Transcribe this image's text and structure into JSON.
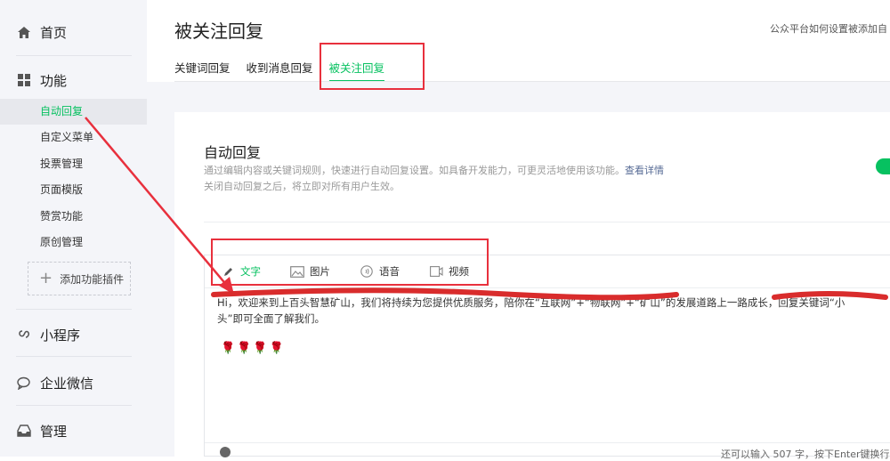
{
  "sidebar": {
    "home": "首页",
    "features": "功能",
    "items": [
      "自动回复",
      "自定义菜单",
      "投票管理",
      "页面模版",
      "赞赏功能",
      "原创管理"
    ],
    "add_plugin": "添加功能插件",
    "miniprogram": "小程序",
    "wework": "企业微信",
    "manage": "管理"
  },
  "header": {
    "title": "被关注回复",
    "help": "公众平台如何设置被添加自",
    "tabs": [
      "关键词回复",
      "收到消息回复",
      "被关注回复"
    ],
    "active_tab": 2
  },
  "card": {
    "title": "自动回复",
    "desc_line1": "通过编辑内容或关键词规则，快速进行自动回复设置。如具备开发能力，可更灵活地使用该功能。",
    "desc_link": "查看详情",
    "desc_line2": "关闭自动回复之后，将立即对所有用户生效。"
  },
  "editor": {
    "types": [
      "文字",
      "图片",
      "语音",
      "视频"
    ],
    "active_type": 0,
    "message_line1": "Hi，欢迎来到上百头智慧矿山，我们将持续为您提供优质服务，陪你在“互联网”+“物联网”+“矿山”的发展道路上一路成长，回复关键词“小",
    "message_line2": "头”即可全面了解我们。",
    "roses": "🌹🌹🌹🌹",
    "counter": "还可以输入 507 字，按下Enter键换行"
  },
  "colors": {
    "accent": "#07c160",
    "annotation": "#e8303d",
    "link": "#576b95"
  }
}
